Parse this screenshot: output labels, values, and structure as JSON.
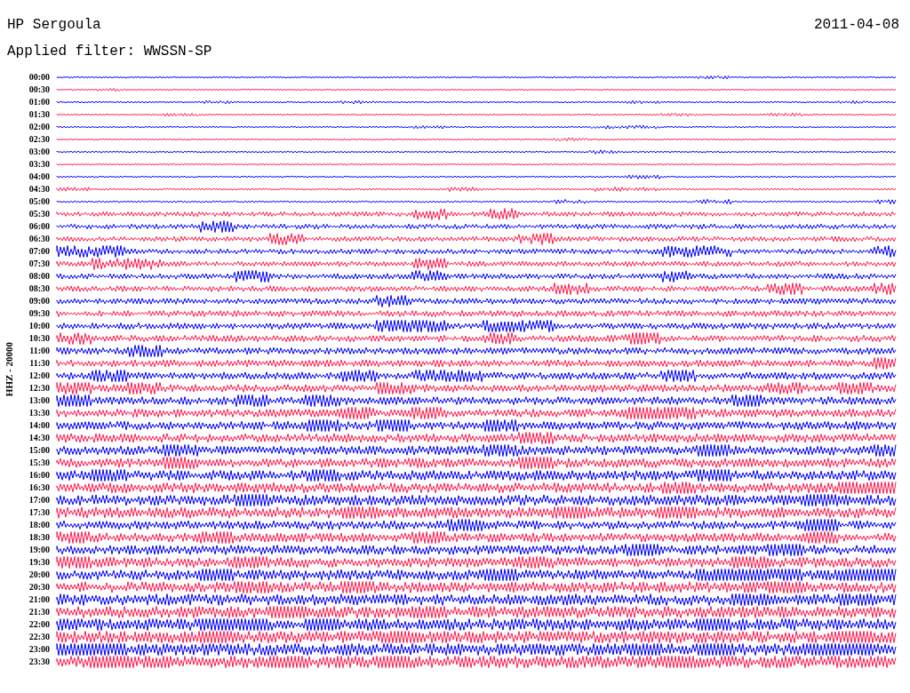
{
  "header": {
    "station": "HP Sergoula",
    "filter": "Applied filter: WWSSN-SP",
    "date": "2011-04-08"
  },
  "channel_label": "HHZ - 20000",
  "rows": [
    {
      "time": "00:00",
      "color": "#0000ff"
    },
    {
      "time": "00:30",
      "color": "#ff1a4d"
    },
    {
      "time": "01:00",
      "color": "#0000ff"
    },
    {
      "time": "01:30",
      "color": "#ff1a4d"
    },
    {
      "time": "02:00",
      "color": "#0000ff"
    },
    {
      "time": "02:30",
      "color": "#ff1a4d"
    },
    {
      "time": "03:00",
      "color": "#0000ff"
    },
    {
      "time": "03:30",
      "color": "#ff1a4d"
    },
    {
      "time": "04:00",
      "color": "#0000ff"
    },
    {
      "time": "04:30",
      "color": "#ff1a4d"
    },
    {
      "time": "05:00",
      "color": "#0000ff"
    },
    {
      "time": "05:30",
      "color": "#ff1a4d"
    },
    {
      "time": "06:00",
      "color": "#0000ff"
    },
    {
      "time": "06:30",
      "color": "#ff1a4d"
    },
    {
      "time": "07:00",
      "color": "#0000ff"
    },
    {
      "time": "07:30",
      "color": "#ff1a4d"
    },
    {
      "time": "08:00",
      "color": "#0000ff"
    },
    {
      "time": "08:30",
      "color": "#ff1a4d"
    },
    {
      "time": "09:00",
      "color": "#0000ff"
    },
    {
      "time": "09:30",
      "color": "#ff1a4d"
    },
    {
      "time": "10:00",
      "color": "#0000ff"
    },
    {
      "time": "10:30",
      "color": "#ff1a4d"
    },
    {
      "time": "11:00",
      "color": "#0000ff"
    },
    {
      "time": "11:30",
      "color": "#ff1a4d"
    },
    {
      "time": "12:00",
      "color": "#0000ff"
    },
    {
      "time": "12:30",
      "color": "#ff1a4d"
    },
    {
      "time": "13:00",
      "color": "#0000ff"
    },
    {
      "time": "13:30",
      "color": "#ff1a4d"
    },
    {
      "time": "14:00",
      "color": "#0000ff"
    },
    {
      "time": "14:30",
      "color": "#ff1a4d"
    },
    {
      "time": "15:00",
      "color": "#0000ff"
    },
    {
      "time": "15:30",
      "color": "#ff1a4d"
    },
    {
      "time": "16:00",
      "color": "#0000ff"
    },
    {
      "time": "16:30",
      "color": "#ff1a4d"
    },
    {
      "time": "17:00",
      "color": "#0000ff"
    },
    {
      "time": "17:30",
      "color": "#ff1a4d"
    },
    {
      "time": "18:00",
      "color": "#0000ff"
    },
    {
      "time": "18:30",
      "color": "#ff1a4d"
    },
    {
      "time": "19:00",
      "color": "#0000ff"
    },
    {
      "time": "19:30",
      "color": "#ff1a4d"
    },
    {
      "time": "20:00",
      "color": "#0000ff"
    },
    {
      "time": "20:30",
      "color": "#ff1a4d"
    },
    {
      "time": "21:00",
      "color": "#0000ff"
    },
    {
      "time": "21:30",
      "color": "#ff1a4d"
    },
    {
      "time": "22:00",
      "color": "#0000ff"
    },
    {
      "time": "22:30",
      "color": "#ff1a4d"
    },
    {
      "time": "23:00",
      "color": "#0000ff"
    },
    {
      "time": "23:30",
      "color": "#ff1a4d"
    }
  ]
}
